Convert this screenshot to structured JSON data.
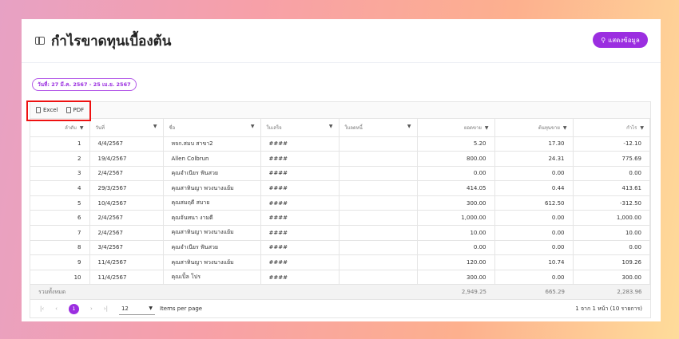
{
  "header": {
    "title": "กำไรขาดทุนเบื้องต้น",
    "show_button": "แสดงข้อมูล"
  },
  "date_chip": "วันที่: 27 มี.ค. 2567 - 25 เม.ย. 2567",
  "toolbar": {
    "excel": "Excel",
    "pdf": "PDF"
  },
  "columns": [
    "ลำดับ",
    "วันที่",
    "ชื่อ",
    "ใบเสร็จ",
    "ใบลดหนี้",
    "ยอดขาย",
    "ต้นทุนขาย",
    "กำไร"
  ],
  "rows": [
    [
      "1",
      "4/4/2567",
      "หจก.สมบ สาขา2",
      "####",
      "",
      "5.20",
      "17.30",
      "-12.10"
    ],
    [
      "2",
      "19/4/2567",
      "Allen Colbrun",
      "####",
      "",
      "800.00",
      "24.31",
      "775.69"
    ],
    [
      "3",
      "2/4/2567",
      "คุณจำเนียร ฟันสวย",
      "####",
      "",
      "0.00",
      "0.00",
      "0.00"
    ],
    [
      "4",
      "29/3/2567",
      "คุณสาทินญา พวงนางแย้ม",
      "####",
      "",
      "414.05",
      "0.44",
      "413.61"
    ],
    [
      "5",
      "10/4/2567",
      "คุณสมฤดี สบาย",
      "####",
      "",
      "300.00",
      "612.50",
      "-312.50"
    ],
    [
      "6",
      "2/4/2567",
      "คุณจันทนา งามดี",
      "####",
      "",
      "1,000.00",
      "0.00",
      "1,000.00"
    ],
    [
      "7",
      "2/4/2567",
      "คุณสาทินญา พวงนางแย้ม",
      "####",
      "",
      "10.00",
      "0.00",
      "10.00"
    ],
    [
      "8",
      "3/4/2567",
      "คุณจำเนียร ฟันสวย",
      "####",
      "",
      "0.00",
      "0.00",
      "0.00"
    ],
    [
      "9",
      "11/4/2567",
      "คุณสาทินญา พวงนางแย้ม",
      "####",
      "",
      "120.00",
      "10.74",
      "109.26"
    ],
    [
      "10",
      "11/4/2567",
      "คุณเปิ้ล โปร",
      "####",
      "",
      "300.00",
      "0.00",
      "300.00"
    ]
  ],
  "totals": {
    "label": "รวมทั้งหมด",
    "sales": "2,949.25",
    "cost": "665.29",
    "profit": "2,283.96"
  },
  "pager": {
    "current": "1",
    "page_size": "12",
    "items_per_page": "Items per page",
    "info": "1 จาก 1 หน้า (10 รายการ)"
  }
}
